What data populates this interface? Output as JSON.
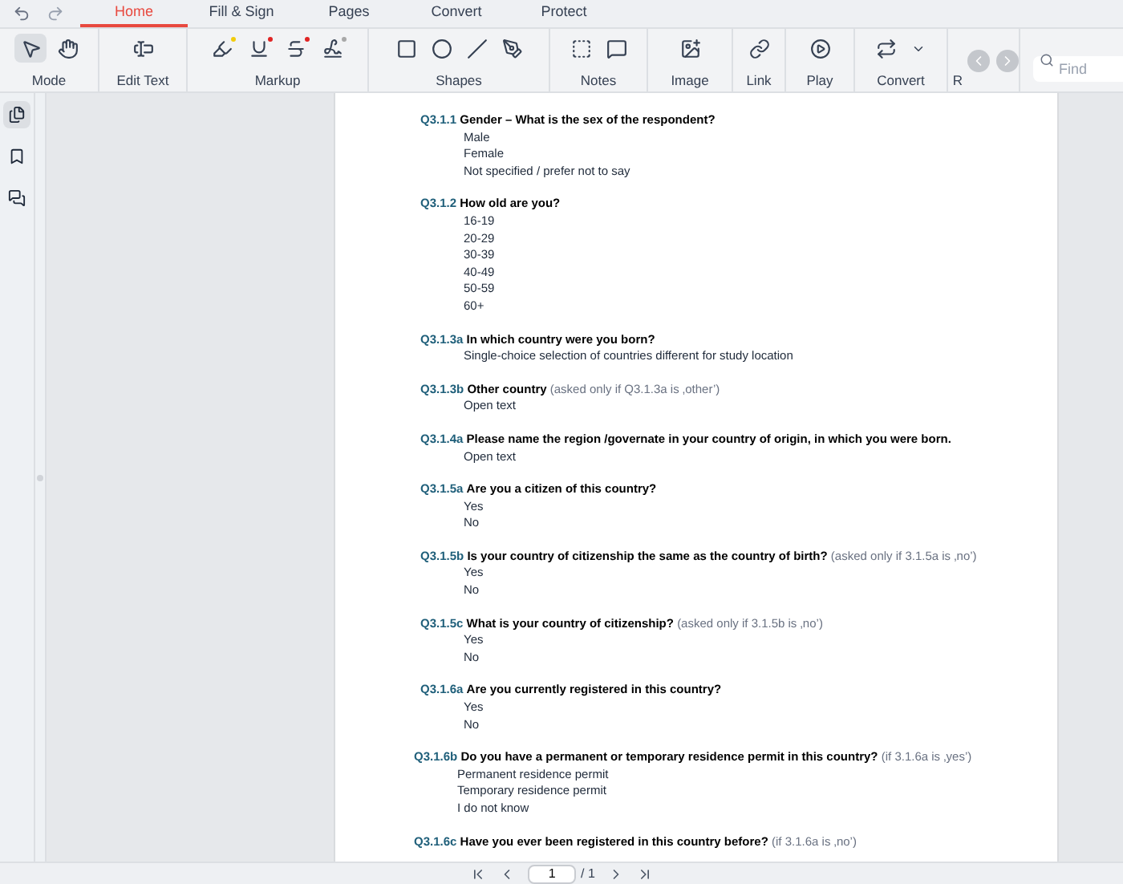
{
  "tabs": [
    {
      "label": "Home",
      "selected": true
    },
    {
      "label": "Fill & Sign",
      "selected": false
    },
    {
      "label": "Pages",
      "selected": false
    },
    {
      "label": "Convert",
      "selected": false
    },
    {
      "label": "Protect",
      "selected": false
    }
  ],
  "toolbar": [
    {
      "label": "Mode",
      "tools": [
        {
          "selected": true
        },
        {
          "selected": false
        }
      ]
    },
    {
      "label": "Edit Text"
    },
    {
      "label": "Markup",
      "tools": [
        {
          "color": "#f2cc0c"
        },
        {
          "color": "#e02424"
        },
        {
          "color": "#e02424"
        },
        {
          "color": "#a8a8a8"
        }
      ]
    },
    {
      "label": "Shapes"
    },
    {
      "label": "Notes"
    },
    {
      "label": "Image"
    },
    {
      "label": "Link"
    },
    {
      "label": "Play"
    },
    {
      "label": "Convert"
    },
    {
      "label": "R"
    }
  ],
  "search": {
    "placeholder": "Find"
  },
  "sidebar": [
    {
      "selected": true
    },
    {
      "selected": false
    },
    {
      "selected": false
    }
  ],
  "questions": [
    {
      "id": "Q3.1.1",
      "text": "Gender – What is the sex of the respondent?",
      "options": [
        "Male",
        "Female",
        "Not specified / prefer not to say"
      ]
    },
    {
      "id": "Q3.1.2",
      "text": "How old are you?",
      "options": [
        "16-19",
        "20-29",
        "30-39",
        "40-49",
        "50-59",
        "60+"
      ]
    },
    {
      "id": "Q3.1.3a",
      "text": "In which country were you born?",
      "options": [
        "Single-choice selection of countries different for study location"
      ]
    },
    {
      "id": "Q3.1.3b",
      "text": "Other country",
      "condition": "(asked only if Q3.1.3a is ‚other’)",
      "options": [
        "Open text"
      ]
    },
    {
      "id": "Q3.1.4a",
      "text": "Please name the region /governate in your country of origin, in which you were born.",
      "options": [
        "Open text"
      ]
    },
    {
      "id": "Q3.1.5a",
      "text": "Are you a citizen of this country?",
      "options": [
        "Yes",
        "No"
      ]
    },
    {
      "id": "Q3.1.5b",
      "text": "Is your country of citizenship the same as the country of birth?",
      "condition": "(asked only if 3.1.5a is ‚no’)",
      "options": [
        "Yes",
        "No"
      ]
    },
    {
      "id": "Q3.1.5c",
      "text": "What is your country of citizenship?",
      "condition": "(asked only if 3.1.5b is ‚no’)",
      "options": [
        "Yes",
        "No"
      ]
    },
    {
      "id": "Q3.1.6a",
      "text": "Are you currently registered in this country?",
      "options": [
        "Yes",
        "No"
      ]
    },
    {
      "id": "Q3.1.6b",
      "text": "Do you have a permanent or temporary residence permit in this country?",
      "condition": "(if 3.1.6a is ‚yes’)",
      "options": [
        "Permanent residence permit",
        "Temporary residence permit",
        "I do not know"
      ]
    },
    {
      "id": "Q3.1.6c",
      "text": "Have you ever been registered in this country before?",
      "condition": "(if 3.1.6a is ‚no’)"
    }
  ],
  "pager": {
    "page": "1",
    "total": "/ 1"
  }
}
